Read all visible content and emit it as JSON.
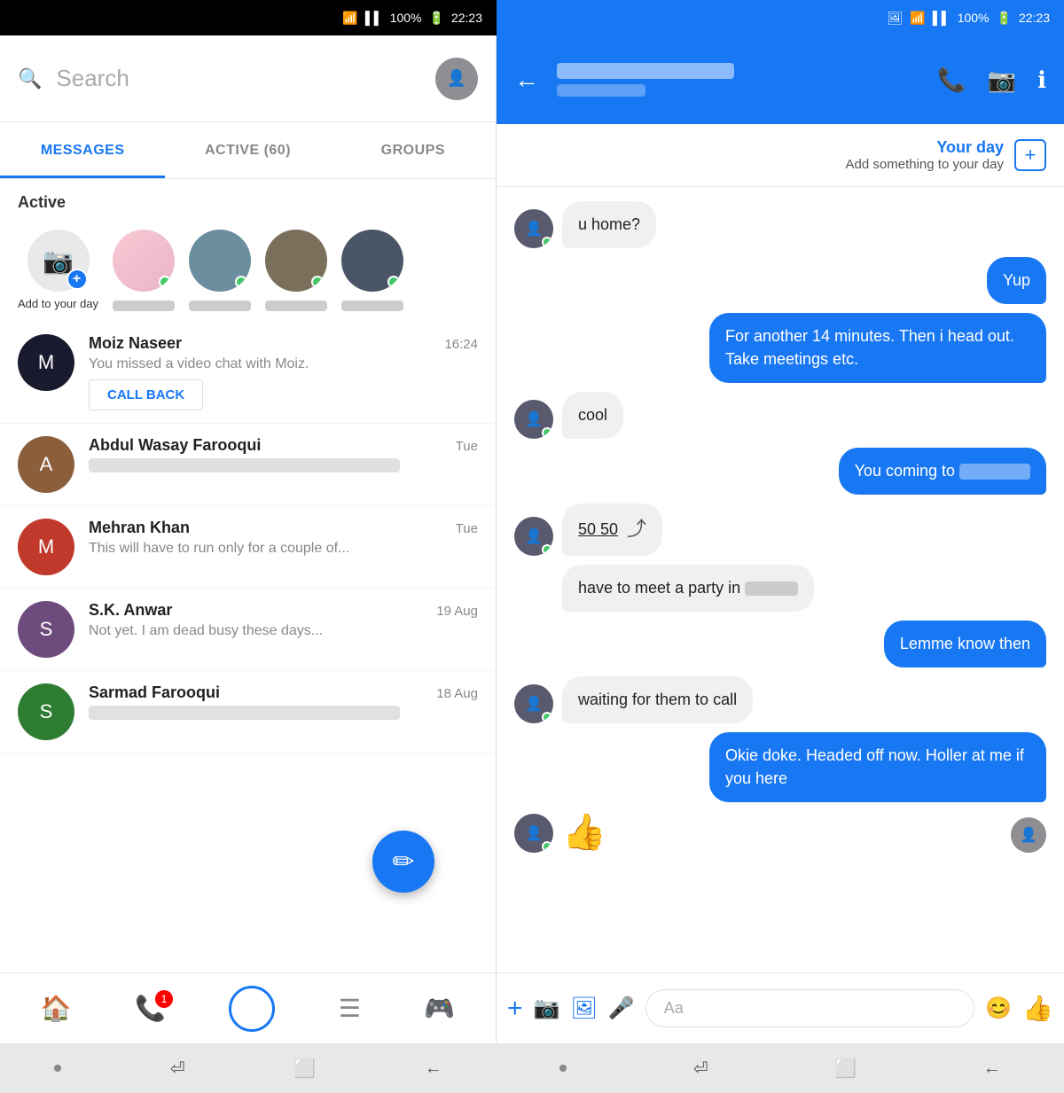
{
  "status": {
    "time": "22:23",
    "battery": "100%",
    "signal_icons": "📶"
  },
  "left_panel": {
    "search_placeholder": "Search",
    "tabs": [
      {
        "label": "MESSAGES",
        "active": true
      },
      {
        "label": "ACTIVE (60)",
        "active": false
      },
      {
        "label": "GROUPS",
        "active": false
      }
    ],
    "active_label": "Active",
    "story_add_label": "Add to your day",
    "messages": [
      {
        "name": "Moiz Naseer",
        "time": "16:24",
        "preview": "You missed a video chat with Moiz.",
        "has_callback": true,
        "callback_label": "CALL BACK"
      },
      {
        "name": "Abdul Wasay Farooqui",
        "time": "Tue",
        "preview": "",
        "has_callback": false
      },
      {
        "name": "Mehran Khan",
        "time": "Tue",
        "preview": "This will have to run only for a couple of...",
        "has_callback": false
      },
      {
        "name": "S.K. Anwar",
        "time": "19 Aug",
        "preview": "Not yet. I am dead busy these days...",
        "has_callback": false
      },
      {
        "name": "Sarmad Farooqui",
        "time": "18 Aug",
        "preview": "",
        "has_callback": false
      }
    ],
    "nav": {
      "home": "🏠",
      "phone": "📞",
      "circle": "⬜",
      "list": "☰",
      "game": "🎮",
      "phone_badge": "1"
    }
  },
  "right_panel": {
    "back_icon": "←",
    "your_day_title": "Your day",
    "your_day_sub": "Add something to your day",
    "plus_icon": "+",
    "messages": [
      {
        "id": 1,
        "type": "received",
        "text": "u home?",
        "has_avatar": true
      },
      {
        "id": 2,
        "type": "sent",
        "text": "Yup"
      },
      {
        "id": 3,
        "type": "sent",
        "text": "For another 14 minutes. Then i head out. Take meetings etc."
      },
      {
        "id": 4,
        "type": "received",
        "text": "cool",
        "has_avatar": true
      },
      {
        "id": 5,
        "type": "sent",
        "text": "You coming to"
      },
      {
        "id": 6,
        "type": "received",
        "text": "50 50",
        "has_share": true,
        "has_avatar": true
      },
      {
        "id": 7,
        "type": "received",
        "text": "have to meet a party in",
        "has_avatar": false,
        "blurred_suffix": true
      },
      {
        "id": 8,
        "type": "sent",
        "text": "Lemme know then"
      },
      {
        "id": 9,
        "type": "received",
        "text": "waiting for them to call",
        "has_avatar": true
      },
      {
        "id": 10,
        "type": "sent",
        "text": "Okie doke. Headed off now. Holler at me if you here"
      },
      {
        "id": 11,
        "type": "received",
        "text": "👍",
        "is_emoji": true,
        "has_avatar": true
      }
    ],
    "input": {
      "placeholder": "Aa",
      "plus_icon": "+",
      "camera_icon": "📷",
      "image_icon": "🖼",
      "mic_icon": "🎤",
      "emoji_icon": "😊",
      "like_icon": "👍"
    }
  },
  "system_nav": {
    "dot": "•",
    "enter_icon": "⏎",
    "square_icon": "⬜",
    "back_icon": "←"
  }
}
